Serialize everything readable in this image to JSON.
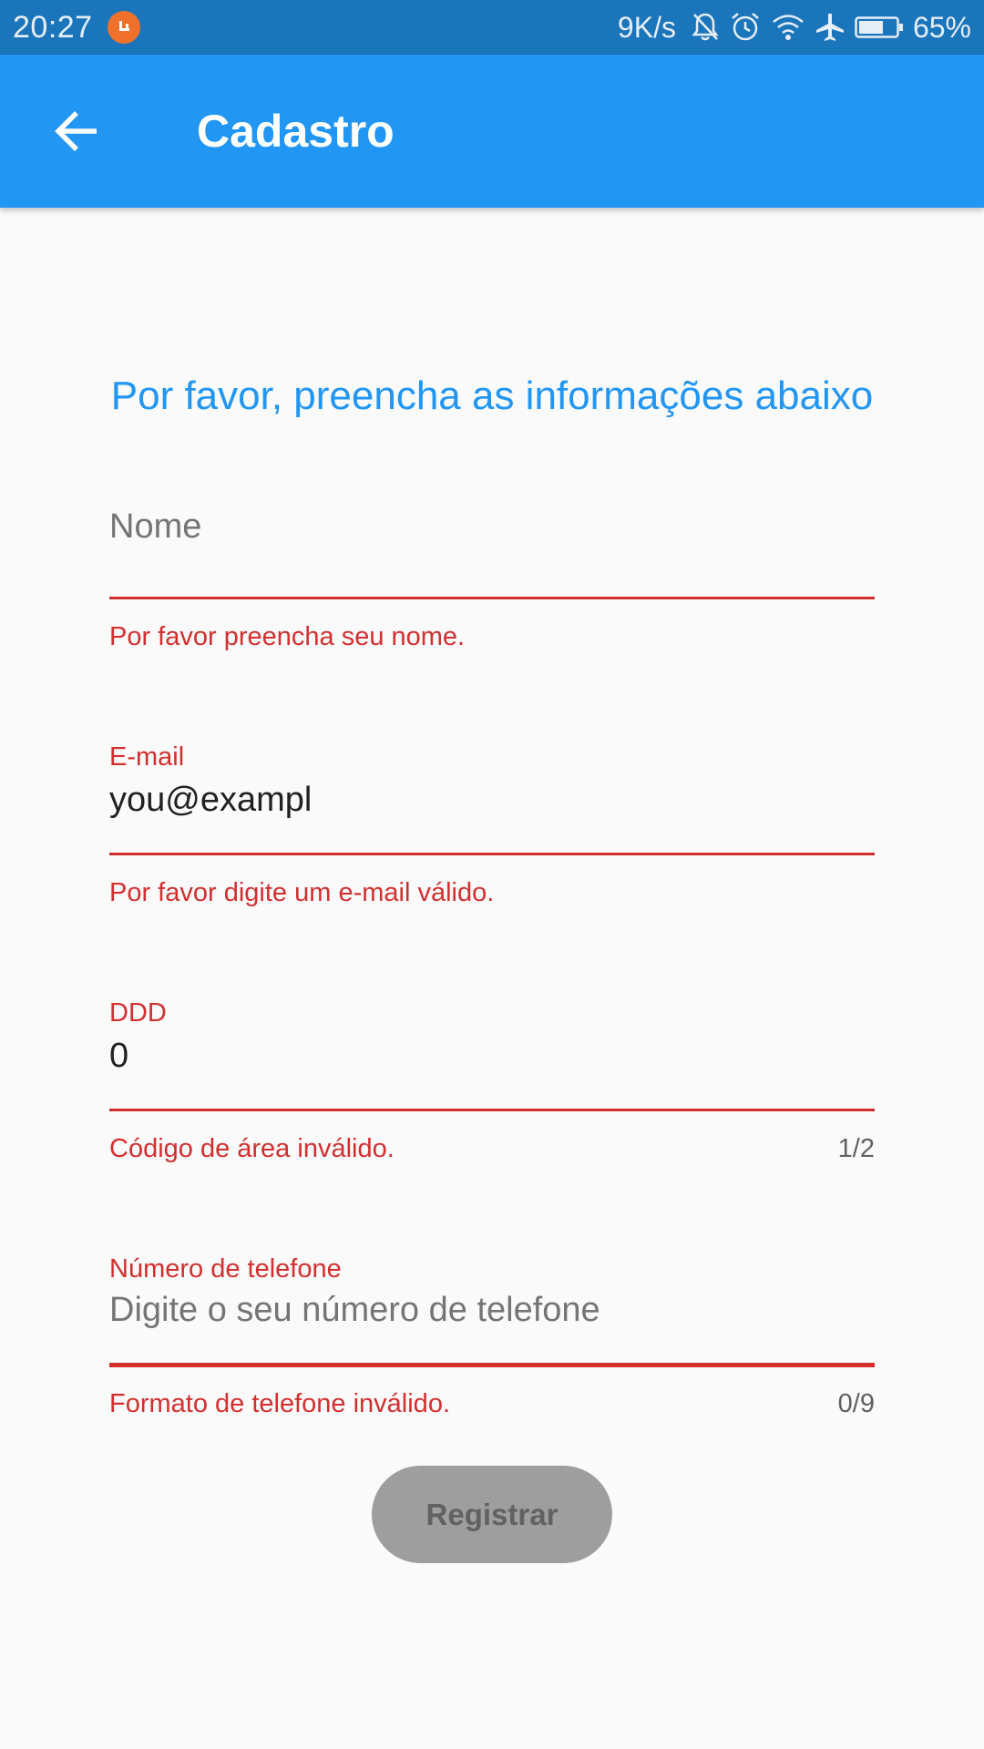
{
  "status_bar": {
    "time": "20:27",
    "network_speed": "9K/s",
    "battery_percent": "65%",
    "battery_level": 0.65,
    "icons": [
      "app-notification-icon",
      "bell-off-icon",
      "alarm-icon",
      "wifi-icon",
      "airplane-icon",
      "battery-icon"
    ]
  },
  "app_bar": {
    "title": "Cadastro",
    "back_icon": "arrow-back-icon"
  },
  "form": {
    "intro": "Por favor, preencha as informações abaixo",
    "name": {
      "placeholder": "Nome",
      "error": "Por favor preencha seu nome."
    },
    "email": {
      "label": "E-mail",
      "value": "you@exampl",
      "error": "Por favor digite um e-mail válido."
    },
    "ddd": {
      "label": "DDD",
      "value": "0",
      "error": "Código de área inválido.",
      "counter": "1/2"
    },
    "phone": {
      "label": "Número de telefone",
      "placeholder": "Digite o seu número de telefone",
      "error": "Formato de telefone inválido.",
      "counter": "0/9"
    },
    "register_label": "Registrar"
  },
  "colors": {
    "primary": "#2196f3",
    "status_bar": "#1b75bb",
    "error": "#d32f2f",
    "disabled_button": "#9e9e9e"
  }
}
